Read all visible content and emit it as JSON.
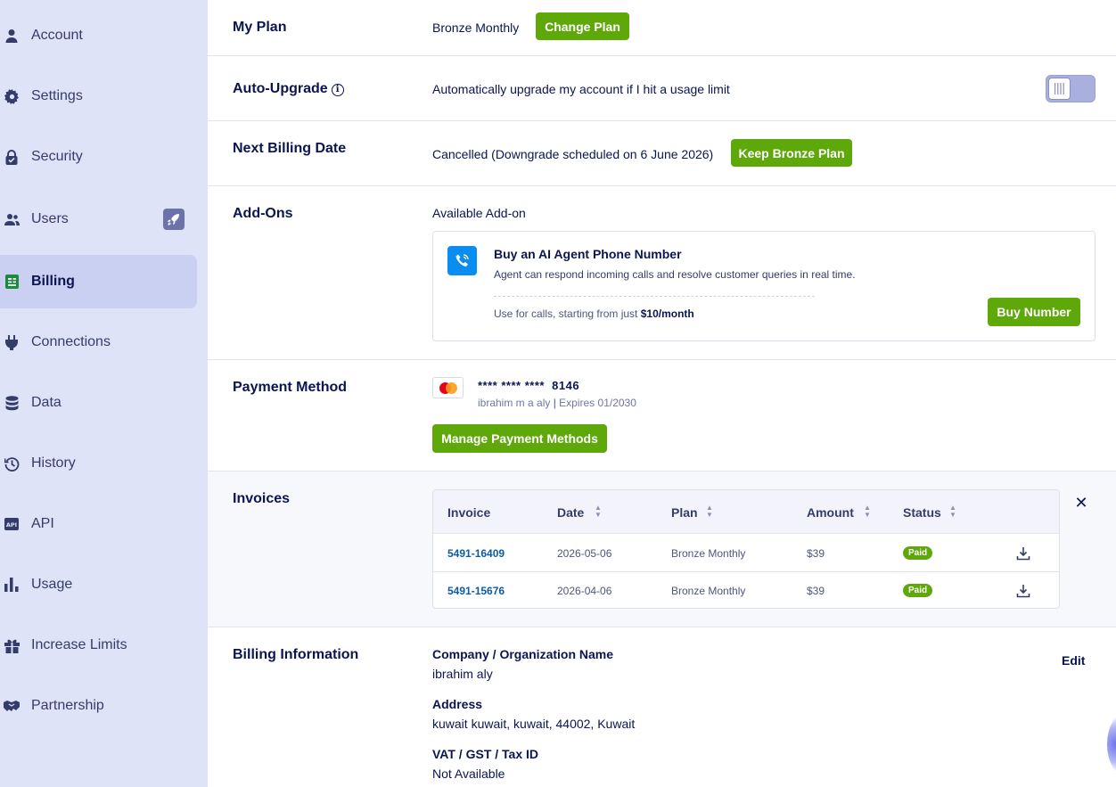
{
  "sidebar": {
    "items": [
      {
        "label": "Account",
        "icon": "user-icon"
      },
      {
        "label": "Settings",
        "icon": "gear-icon"
      },
      {
        "label": "Security",
        "icon": "lock-icon"
      },
      {
        "label": "Users",
        "icon": "users-icon",
        "badge_icon": "rocket-icon"
      },
      {
        "label": "Billing",
        "icon": "billing-icon",
        "active": true
      },
      {
        "label": "Connections",
        "icon": "plug-icon"
      },
      {
        "label": "Data",
        "icon": "database-icon"
      },
      {
        "label": "History",
        "icon": "history-icon"
      },
      {
        "label": "API",
        "icon": "api-icon"
      },
      {
        "label": "Usage",
        "icon": "bar-chart-icon"
      },
      {
        "label": "Increase Limits",
        "icon": "gift-icon"
      },
      {
        "label": "Partnership",
        "icon": "handshake-icon"
      }
    ]
  },
  "plan": {
    "title": "My Plan",
    "value": "Bronze Monthly",
    "button": "Change Plan"
  },
  "auto_upgrade": {
    "title": "Auto-Upgrade",
    "description": "Automatically upgrade my account if I hit a usage limit",
    "enabled": false
  },
  "next_billing": {
    "title": "Next Billing Date",
    "value": "Cancelled (Downgrade scheduled on 6 June 2026)",
    "button": "Keep Bronze Plan"
  },
  "addons": {
    "title": "Add-Ons",
    "subtitle": "Available Add-on",
    "card": {
      "title": "Buy an AI Agent Phone Number",
      "description": "Agent can respond incoming calls and resolve customer queries in real time.",
      "price_prefix": "Use for calls, starting from just",
      "price": "$10/month",
      "button": "Buy Number"
    }
  },
  "payment": {
    "title": "Payment Method",
    "card_mask": "**** **** ****",
    "card_last4": "8146",
    "holder": "ibrahim m a aly",
    "expires": "Expires 01/2030",
    "button": "Manage Payment Methods"
  },
  "invoices": {
    "title": "Invoices",
    "columns": [
      "Invoice",
      "Date",
      "Plan",
      "Amount",
      "Status"
    ],
    "rows": [
      {
        "invoice": "5491-16409",
        "date": "2026-05-06",
        "plan": "Bronze Monthly",
        "amount": "$39",
        "status": "Paid"
      },
      {
        "invoice": "5491-15676",
        "date": "2026-04-06",
        "plan": "Bronze Monthly",
        "amount": "$39",
        "status": "Paid"
      }
    ]
  },
  "billing_info": {
    "title": "Billing Information",
    "edit": "Edit",
    "company_label": "Company / Organization Name",
    "company_value": "ibrahim aly",
    "address_label": "Address",
    "address_value": "kuwait kuwait, kuwait, 44002, Kuwait",
    "vat_label": "VAT / GST / Tax ID",
    "vat_value": "Not Available"
  },
  "colors": {
    "accent_green": "#5ea80a",
    "sidebar_bg": "#dfe3f7",
    "active_bg": "#c9d0f1",
    "text_dark": "#0a1551"
  }
}
